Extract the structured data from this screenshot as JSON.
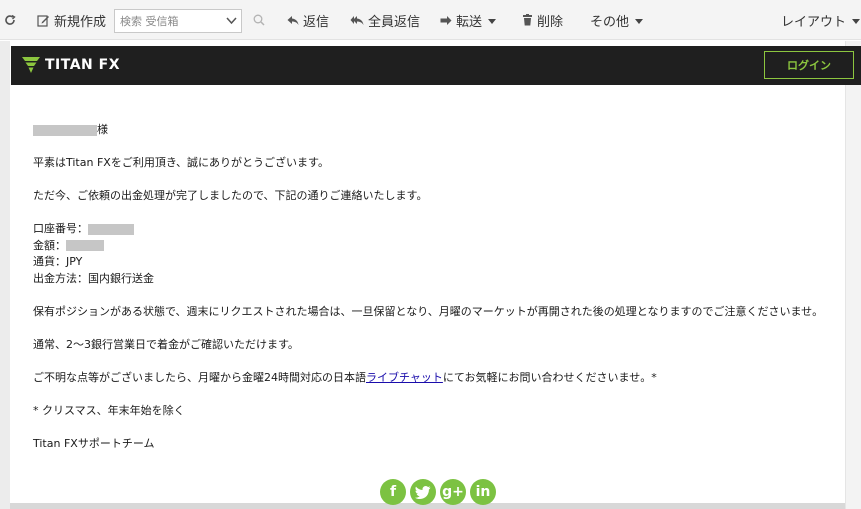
{
  "toolbar": {
    "new_label": "新規作成",
    "search_placeholder": "検索 受信箱",
    "reply_label": "返信",
    "reply_all_label": "全員返信",
    "forward_label": "転送",
    "delete_label": "削除",
    "more_label": "その他",
    "layout_label": "レイアウト"
  },
  "brand": {
    "logo_main": "TITAN",
    "logo_fx": "FX",
    "login_label": "ログイン",
    "accent_color": "#8cc63f"
  },
  "mail": {
    "salutation_suffix": "様",
    "line1": "平素はTitan FXをご利用頂き、誠にありがとうございます。",
    "line2": "ただ今、ご依頼の出金処理が完了しましたので、下記の通りご連絡いたします。",
    "account_label": "口座番号：",
    "amount_label": "金額：",
    "currency_line": "通貨：JPY",
    "method_line": "出金方法：国内銀行送金",
    "line3": "保有ポジションがある状態で、週末にリクエストされた場合は、一旦保留となり、月曜のマーケットが再開された後の処理となりますのでご注意くださいませ。",
    "line4": "通常、2〜3銀行営業日で着金がご確認いただけます。",
    "line5_before": "ご不明な点等がございましたら、月曜から金曜24時間対応の日本語",
    "line5_link": "ライブチャット",
    "line5_after": "にてお気軽にお問い合わせくださいませ。*",
    "line6": "* クリスマス、年末年始を除く",
    "signature": "Titan FXサポートチーム"
  },
  "social": {
    "facebook": "f",
    "googleplus": "g+",
    "linkedin": "in"
  }
}
